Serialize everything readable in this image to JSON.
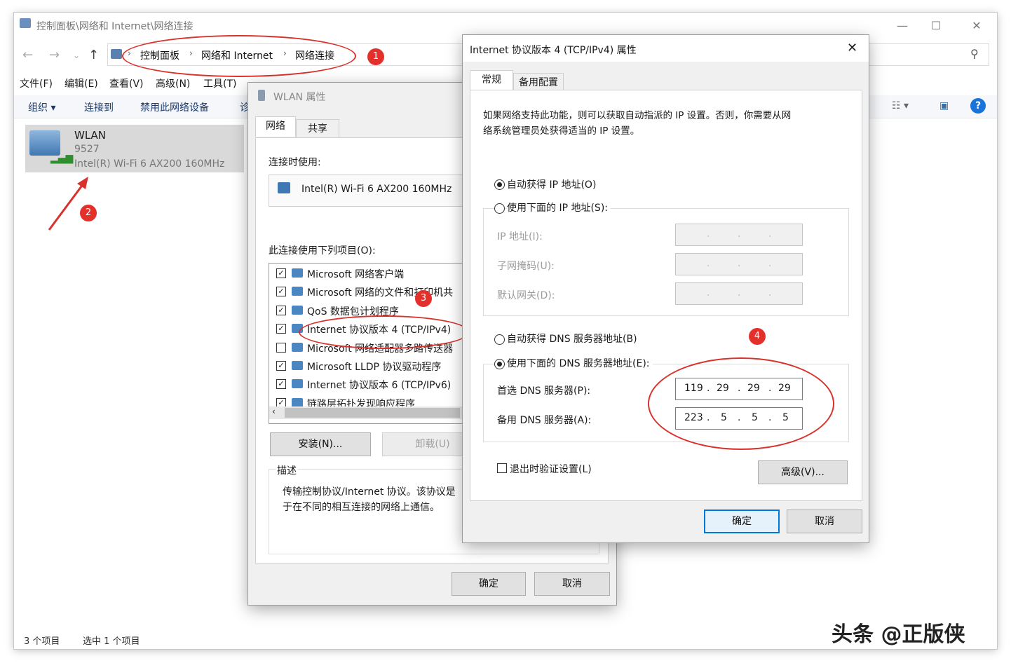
{
  "explorer": {
    "title": "控制面板\\网络和 Internet\\网络连接",
    "breadcrumb": [
      "控制面板",
      "网络和 Internet",
      "网络连接"
    ],
    "menu": [
      "文件(F)",
      "编辑(E)",
      "查看(V)",
      "高级(N)",
      "工具(T)"
    ],
    "toolbar": [
      "组织 ▾",
      "连接到",
      "禁用此网络设备",
      "诊"
    ],
    "wlan": {
      "name": "WLAN",
      "ssid": "9527",
      "adapter": "Intel(R) Wi-Fi 6 AX200 160MHz"
    },
    "status": {
      "count": "3 个项目",
      "selected": "选中 1 个项目"
    }
  },
  "wlan_dialog": {
    "title": "WLAN 属性",
    "tabs": [
      "网络",
      "共享"
    ],
    "connect_using_label": "连接时使用:",
    "adapter": "Intel(R) Wi-Fi 6 AX200 160MHz",
    "items_label": "此连接使用下列项目(O):",
    "items": [
      {
        "label": "Microsoft 网络客户端",
        "checked": true
      },
      {
        "label": "Microsoft 网络的文件和打印机共",
        "checked": true
      },
      {
        "label": "QoS 数据包计划程序",
        "checked": true
      },
      {
        "label": "Internet 协议版本 4 (TCP/IPv4)",
        "checked": true
      },
      {
        "label": "Microsoft 网络适配器多路传送器",
        "checked": false
      },
      {
        "label": "Microsoft LLDP 协议驱动程序",
        "checked": true
      },
      {
        "label": "Internet 协议版本 6 (TCP/IPv6)",
        "checked": true
      },
      {
        "label": "链路层拓扑发现响应程序",
        "checked": true
      }
    ],
    "install": "安装(N)...",
    "uninstall": "卸载(U)",
    "desc_label": "描述",
    "desc_line1": "传输控制协议/Internet 协议。该协议是",
    "desc_line2": "于在不同的相互连接的网络上通信。",
    "ok": "确定",
    "cancel": "取消"
  },
  "ipv4_dialog": {
    "title": "Internet 协议版本 4 (TCP/IPv4) 属性",
    "tabs": [
      "常规",
      "备用配置"
    ],
    "intro1": "如果网络支持此功能，则可以获取自动指派的 IP 设置。否则，你需要从网",
    "intro2": "络系统管理员处获得适当的 IP 设置。",
    "auto_ip": "自动获得 IP 地址(O)",
    "manual_ip": "使用下面的 IP 地址(S):",
    "ip_label": "IP 地址(I):",
    "mask_label": "子网掩码(U):",
    "gateway_label": "默认网关(D):",
    "auto_dns": "自动获得 DNS 服务器地址(B)",
    "manual_dns": "使用下面的 DNS 服务器地址(E):",
    "dns1_label": "首选 DNS 服务器(P):",
    "dns2_label": "备用 DNS 服务器(A):",
    "dns1": [
      "119",
      "29",
      "29",
      "29"
    ],
    "dns2": [
      "223",
      "5",
      "5",
      "5"
    ],
    "validate": "退出时验证设置(L)",
    "advanced": "高级(V)...",
    "ok": "确定",
    "cancel": "取消"
  },
  "annotations": {
    "b1": "1",
    "b2": "2",
    "b3": "3",
    "b4": "4"
  },
  "watermark": "头条 @正版侠"
}
